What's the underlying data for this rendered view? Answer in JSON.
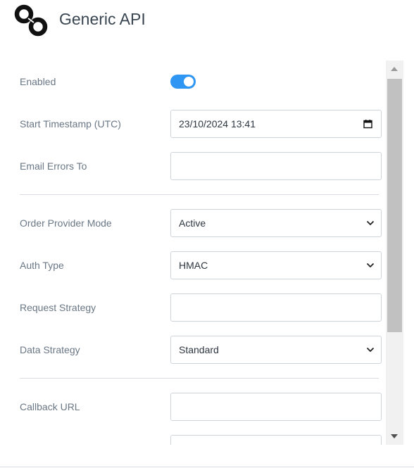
{
  "header": {
    "title": "Generic API",
    "logo_icon": "chain-link-icon"
  },
  "form": {
    "enabled": {
      "label": "Enabled",
      "value": true
    },
    "start_timestamp": {
      "label": "Start Timestamp (UTC)",
      "value": "23/10/2024 13:41",
      "icon": "calendar-icon"
    },
    "email_errors_to": {
      "label": "Email Errors To",
      "value": ""
    },
    "order_provider_mode": {
      "label": "Order Provider Mode",
      "value": "Active"
    },
    "auth_type": {
      "label": "Auth Type",
      "value": "HMAC"
    },
    "request_strategy": {
      "label": "Request Strategy",
      "value": ""
    },
    "data_strategy": {
      "label": "Data Strategy",
      "value": "Standard"
    },
    "callback_url": {
      "label": "Callback URL",
      "value": ""
    }
  },
  "colors": {
    "accent": "#2f96f3",
    "label": "#6a7785",
    "title": "#3a4652"
  }
}
